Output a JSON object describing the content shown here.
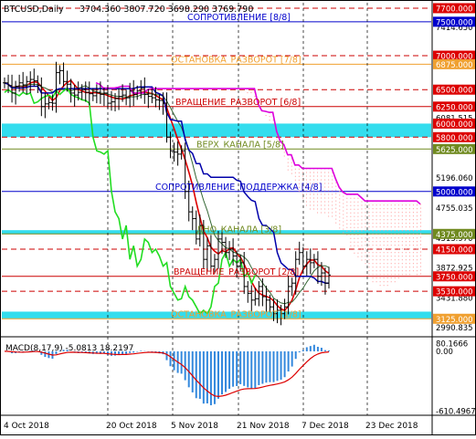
{
  "header": {
    "symbol": "BTCUSD,Daily",
    "ohlc": "3704.360 3807.720 3698.290 3769.790"
  },
  "colors": {
    "background": "#ffffff",
    "price_bar": "#000000",
    "murrey_red": "#cc0000",
    "murrey_blue": "#0000cc",
    "murrey_orange": "#f0a030",
    "murrey_green": "#708a20",
    "cyan_band": "#33ddee",
    "magenta_line": "#dd00dd",
    "green_line": "#22dd22",
    "navy_line": "#0000aa",
    "red_ma": "#dd0000",
    "olive_ma": "#336633",
    "ichimoku_cloud": "#ff9999",
    "macd_hist": "#3388dd",
    "macd_signal": "#dd0000",
    "axis_label_bg_red": "#dd0000",
    "axis_label_bg_blue": "#0000cc",
    "axis_label_bg_orange": "#f0a030",
    "axis_label_bg_green": "#708a20",
    "axis_label_bg_cyan": "#33ddee"
  },
  "murrey_levels": [
    {
      "label": "СОПРОТИВЛЕНИЕ [8/8]",
      "value": 7500,
      "tag": "7500.000",
      "color_key": "murrey_blue",
      "style": "solid"
    },
    {
      "label": "ОСТАНОВКА_РАЗВОРОТ [7/8]",
      "value": 6875,
      "tag": "6875.000",
      "color_key": "murrey_orange",
      "style": "solid"
    },
    {
      "label": "ВРАЩЕНИЕ_РАЗВОРОТ [6/8]",
      "value": 6250,
      "tag": "6250.000",
      "color_key": "murrey_red",
      "style": "solid"
    },
    {
      "label": "ВЕРХ_КАНАЛА [5/8]",
      "value": 5625,
      "tag": "5625.000",
      "color_key": "murrey_green",
      "style": "solid"
    },
    {
      "label": "СОПРОТИВЛЕНИЕ_ПОДДЕРЖКА [4/8]",
      "value": 5000,
      "tag": "5000.000",
      "color_key": "murrey_blue",
      "style": "solid"
    },
    {
      "label": "ДНО_КАНАЛА [3/8]",
      "value": 4375,
      "tag": "4375.000",
      "color_key": "murrey_green",
      "style": "solid"
    },
    {
      "label": "ВРАЩЕНИЕ_РАЗВОРОТ [2/8]",
      "value": 3750,
      "tag": "3750.000",
      "color_key": "murrey_red",
      "style": "solid"
    },
    {
      "label": "ОСТАНОВКА_РАЗВОРОТ [1/8]",
      "value": 3125,
      "tag": "3125.000",
      "color_key": "murrey_orange",
      "style": "solid"
    }
  ],
  "dashed_levels": [
    {
      "value": 7700,
      "tag": "7700.000"
    },
    {
      "value": 7000,
      "tag": "7000.000"
    },
    {
      "value": 6500,
      "tag": "6500.000"
    },
    {
      "value": 5800,
      "tag": "5800.000"
    },
    {
      "value": 4150,
      "tag": "4150.000"
    },
    {
      "value": 3530,
      "tag": "3530.000"
    }
  ],
  "cyan_bands": [
    {
      "from": 5800,
      "to": 6000,
      "tag": "6000.000"
    },
    {
      "from": 4375,
      "to": 4430
    },
    {
      "from": 3125,
      "to": 3230
    }
  ],
  "price_axis_ticks": [
    {
      "value": 7414.65,
      "text": "7414.650"
    },
    {
      "value": 6081.515,
      "text": "6081.515"
    },
    {
      "value": 5196.06,
      "text": "5196.060"
    },
    {
      "value": 4755.035,
      "text": "4755.035"
    },
    {
      "value": 4313.97,
      "text": "4313.970"
    },
    {
      "value": 3872.925,
      "text": "3872.925"
    },
    {
      "value": 3431.88,
      "text": "3431.880"
    },
    {
      "value": 2990.835,
      "text": "2990.835"
    }
  ],
  "date_axis_ticks": [
    "4 Oct 2018",
    "20 Oct 2018",
    "5 Nov 2018",
    "21 Nov 2018",
    "7 Dec 2018",
    "23 Dec 2018"
  ],
  "macd": {
    "label": "MACD(8,17,9) -5.0813 18.2197",
    "ticks": [
      {
        "value": 80.1666,
        "text": "80.1666"
      },
      {
        "value": 0,
        "text": "0.00"
      },
      {
        "value": -610.4967,
        "text": "-610.4967"
      }
    ]
  },
  "chart_data": {
    "type": "candlestick",
    "title": "BTCUSD,Daily",
    "ylim": [
      2850,
      7800
    ],
    "x": [
      "2018-10-01",
      "2018-10-02",
      "2018-10-03",
      "2018-10-04",
      "2018-10-05",
      "2018-10-06",
      "2018-10-07",
      "2018-10-08",
      "2018-10-09",
      "2018-10-10",
      "2018-10-11",
      "2018-10-12",
      "2018-10-13",
      "2018-10-14",
      "2018-10-15",
      "2018-10-16",
      "2018-10-17",
      "2018-10-18",
      "2018-10-19",
      "2018-10-20",
      "2018-10-21",
      "2018-10-22",
      "2018-10-23",
      "2018-10-24",
      "2018-10-25",
      "2018-10-26",
      "2018-10-27",
      "2018-10-28",
      "2018-10-29",
      "2018-10-30",
      "2018-10-31",
      "2018-11-01",
      "2018-11-02",
      "2018-11-03",
      "2018-11-04",
      "2018-11-05",
      "2018-11-06",
      "2018-11-07",
      "2018-11-08",
      "2018-11-09",
      "2018-11-10",
      "2018-11-11",
      "2018-11-12",
      "2018-11-13",
      "2018-11-14",
      "2018-11-15",
      "2018-11-16",
      "2018-11-17",
      "2018-11-18",
      "2018-11-19",
      "2018-11-20",
      "2018-11-21",
      "2018-11-22",
      "2018-11-23",
      "2018-11-24",
      "2018-11-25",
      "2018-11-26",
      "2018-11-27",
      "2018-11-28",
      "2018-11-29",
      "2018-11-30",
      "2018-12-01",
      "2018-12-02",
      "2018-12-03",
      "2018-12-04",
      "2018-12-05",
      "2018-12-06",
      "2018-12-07",
      "2018-12-08",
      "2018-12-09",
      "2018-12-10",
      "2018-12-11",
      "2018-12-12",
      "2018-12-13",
      "2018-12-14",
      "2018-12-15",
      "2018-12-16",
      "2018-12-17",
      "2018-12-18",
      "2018-12-19",
      "2018-12-20",
      "2018-12-21",
      "2018-12-22",
      "2018-12-23",
      "2018-12-24",
      "2018-12-25",
      "2018-12-26",
      "2018-12-27",
      "2018-12-28"
    ],
    "close": [
      6600,
      6560,
      6450,
      6550,
      6600,
      6570,
      6620,
      6650,
      6630,
      6560,
      6250,
      6290,
      6310,
      6300,
      6750,
      6780,
      6620,
      6580,
      6450,
      6420,
      6460,
      6500,
      6460,
      6440,
      6410,
      6460,
      6430,
      6450,
      6300,
      6320,
      6370,
      6400,
      6420,
      6380,
      6480,
      6430,
      6480,
      6520,
      6430,
      6400,
      6380,
      6350,
      6340,
      6300,
      5800,
      5600,
      5580,
      5550,
      5600,
      5000,
      4700,
      4600,
      4300,
      4500,
      4000,
      4200,
      3900,
      4000,
      4300,
      4250,
      4100,
      4150,
      4050,
      3900,
      3950,
      3600,
      3500,
      3400,
      3420,
      3600,
      3450,
      3400,
      3300,
      3200,
      3250,
      3200,
      3300,
      3600,
      3650,
      4000,
      4100,
      3900,
      4000,
      3950,
      4000,
      3750,
      3800,
      3650,
      3770
    ],
    "series": [
      {
        "name": "cyan_band_level",
        "values": []
      }
    ]
  }
}
